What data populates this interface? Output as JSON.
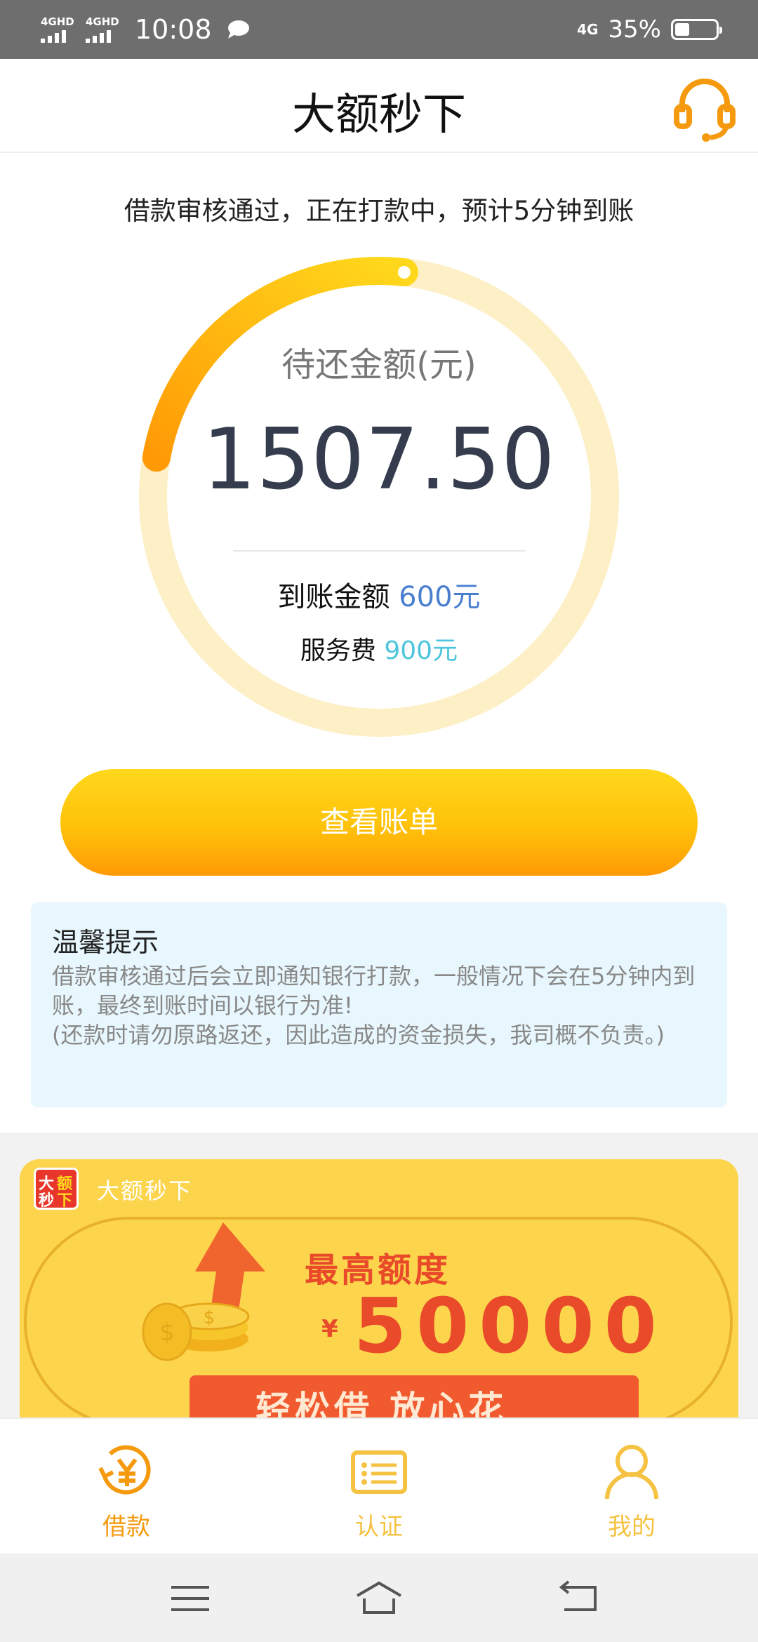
{
  "status_bar": {
    "network1": "4GHD",
    "network2": "4GHD",
    "time": "10:08",
    "net_right": "4G",
    "battery": "35%",
    "battery_level": 0.35
  },
  "header": {
    "title": "大额秒下",
    "support_icon": "headset-icon"
  },
  "main": {
    "notice": "借款审核通过，正在打款中，预计5分钟到账",
    "ring": {
      "label": "待还金额(元)",
      "amount": "1507.50",
      "progress": 0.24,
      "arrived_label": "到账金额",
      "arrived_value": "600元",
      "fee_label": "服务费",
      "fee_value": "900元"
    },
    "view_bill_button": "查看账单",
    "tips": {
      "title": "温馨提示",
      "line1": "借款审核通过后会立即通知银行打款，一般情况下会在5分钟内到账，最终到账时间以银行为准!",
      "line2": "(还款时请勿原路返还，因此造成的资金损失，我司概不负责。)"
    }
  },
  "banner": {
    "brand": "大额秒下",
    "logo_chars": [
      "大",
      "额",
      "秒",
      "下"
    ],
    "quota_label": "最高额度",
    "currency": "¥",
    "max_amount": "50000",
    "slogan": "轻松借 放心花"
  },
  "bottom_nav": {
    "items": [
      {
        "label": "借款",
        "icon": "loan-yen-icon",
        "active": true
      },
      {
        "label": "认证",
        "icon": "id-card-icon",
        "active": false
      },
      {
        "label": "我的",
        "icon": "user-icon",
        "active": false
      }
    ]
  },
  "system_nav": {
    "menu_icon": "menu-icon",
    "home_icon": "home-icon",
    "back_icon": "back-icon"
  },
  "colors": {
    "accent_orange": "#ff9a05",
    "accent_yellow": "#ffd81c",
    "ring_track": "#fdefc6",
    "amount_text": "#343c4d",
    "arrived_value": "#4a7fd0",
    "fee_value": "#4dc5dc"
  }
}
